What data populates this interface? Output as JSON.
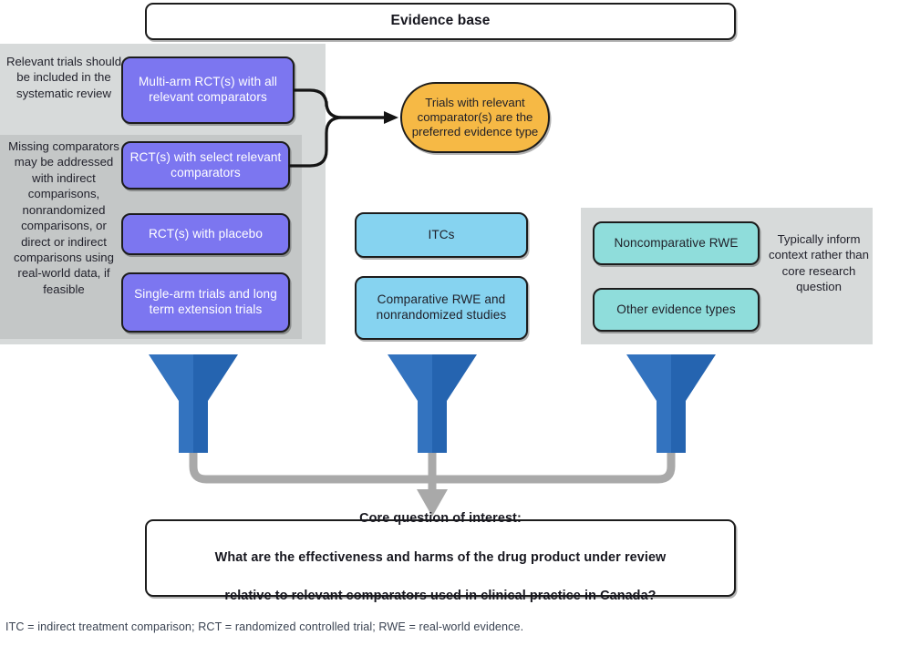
{
  "header": {
    "title": "Evidence base"
  },
  "left_panel": {
    "note_top": "Relevant trials should be included in the systematic review",
    "note_middle": "Missing comparators may be addressed with indirect comparisons, nonrandomized comparisons, or direct or indirect comparisons using real-world data, if feasible",
    "nodes": [
      {
        "label": "Multi-arm RCT(s) with all relevant comparators",
        "color": "#7c76f0"
      },
      {
        "label": "RCT(s) with select relevant comparators",
        "color": "#7c76f0"
      },
      {
        "label": "RCT(s) with placebo",
        "color": "#7c76f0"
      },
      {
        "label": "Single-arm trials and long term extension trials",
        "color": "#7c76f0"
      }
    ]
  },
  "callout": {
    "label": "Trials with relevant comparator(s) are the preferred evidence type",
    "color": "#f6b945"
  },
  "center_column": {
    "nodes": [
      {
        "label": "ITCs",
        "color": "#86d3f0"
      },
      {
        "label": "Comparative RWE and nonrandomized studies",
        "color": "#86d3f0"
      }
    ]
  },
  "right_panel": {
    "note": "Typically inform context rather than core research question",
    "nodes": [
      {
        "label": "Noncomparative RWE",
        "color": "#8fdddb"
      },
      {
        "label": "Other evidence types",
        "color": "#8fdddb"
      }
    ]
  },
  "funnels": {
    "count": 3,
    "fill_light": "#3373bf",
    "fill_dark": "#2564b0",
    "connector_color": "#a9a9a9"
  },
  "bottom": {
    "line1": "Core question of interest:",
    "line2": "What are the effectiveness and harms of the drug product under review",
    "line3": "relative to relevant comparators used in clinical practice in Canada?"
  },
  "footnote": {
    "text": "ITC = indirect treatment comparison; RCT = randomized controlled trial; RWE = real-world evidence."
  }
}
